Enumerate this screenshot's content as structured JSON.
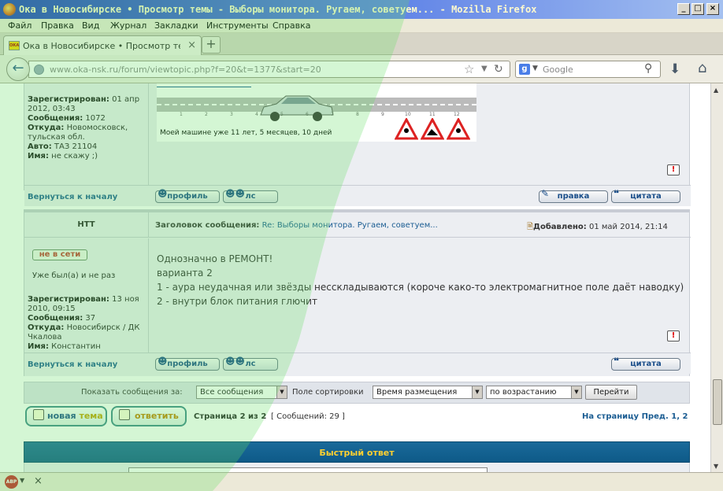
{
  "window": {
    "title": "Ока в Новосибирске • Просмотр темы - Выборы монитора. Ругаем, советуем... - Mozilla Firefox",
    "buttons": {
      "minimize": "_",
      "maximize": "□",
      "close": "×"
    }
  },
  "menu": [
    "Файл",
    "Правка",
    "Вид",
    "Журнал",
    "Закладки",
    "Инструменты",
    "Справка"
  ],
  "tab": {
    "label": "Ока в Новосибирске • Просмотр темы - В...",
    "close": "×",
    "new": "+"
  },
  "nav": {
    "url": "www.oka-nsk.ru/forum/viewtopic.php?f=20&t=1377&start=20",
    "search_placeholder": "Google",
    "search_engine_icon": "google-icon"
  },
  "post1": {
    "registered_label": "Зарегистрирован:",
    "registered_value": "01 апр",
    "registered_value2": "2012, 03:43",
    "posts_label": "Сообщения:",
    "posts_value": "1072",
    "from_label": "Откуда:",
    "from_value": "Новомосковск,",
    "from_value2": "тульская обл.",
    "car_label": "Авто:",
    "car_value": "ТАЗ 21104",
    "name_label": "Имя:",
    "name_value": "не скажу ;)",
    "signature_text": "Моей машине уже 11 лет, 5 месяцев, 10 дней",
    "ticker_numbers": [
      "1",
      "2",
      "3",
      "4",
      "5",
      "6",
      "7",
      "8",
      "9",
      "10",
      "11",
      "12"
    ],
    "back_to_top": "Вернуться к началу",
    "btn_profile": "профиль",
    "btn_pm": "лс",
    "btn_edit": "правка",
    "btn_quote": "цитата"
  },
  "post2": {
    "author": "HTT",
    "subject_label": "Заголовок сообщения:",
    "subject_value": "Re: Выборы монитора. Ругаем, советуем...",
    "added_label": "Добавлено:",
    "added_value": "01 май 2014, 21:14",
    "status": "не в сети",
    "rank": "Уже был(а) и не раз",
    "registered_label": "Зарегистрирован:",
    "registered_value": "13 ноя",
    "registered_value2": "2010, 09:15",
    "posts_label": "Сообщения:",
    "posts_value": "37",
    "from_label": "Откуда:",
    "from_value": "Новосибирск / ДК",
    "from_value2": "Чкалова",
    "name_label": "Имя:",
    "name_value": "Константин",
    "body": [
      "Однозначно в РЕМОНТ!",
      "варианта 2",
      "1 - аура неудачная или звёзды несскладываются (короче како-то электромагнитное поле даёт наводку)",
      "2 - внутри блок питания глючит"
    ],
    "back_to_top": "Вернуться к началу",
    "btn_profile": "профиль",
    "btn_pm": "лс",
    "btn_quote": "цитата"
  },
  "sort": {
    "show_label": "Показать сообщения за:",
    "show_value": "Все сообщения",
    "sort_label": "Поле сортировки",
    "sort_value": "Время размещения",
    "order_value": "по возрастанию",
    "go": "Перейти"
  },
  "pager": {
    "new_topic_a": "новая",
    "new_topic_b": "тема",
    "reply": "ответить",
    "page_info": "Страница 2 из 2",
    "messages": "[ Сообщений: 29 ]",
    "goto_label": "На страницу",
    "prev": "Пред.",
    "pages": [
      "1",
      "2"
    ],
    "sep": ","
  },
  "quick_reply": {
    "title": "Быстрый ответ"
  },
  "colors": {
    "accent": "#1a5c92",
    "header_blue": "#0e5a88",
    "quick_title": "#ffd030",
    "offline": "#c0392b"
  }
}
